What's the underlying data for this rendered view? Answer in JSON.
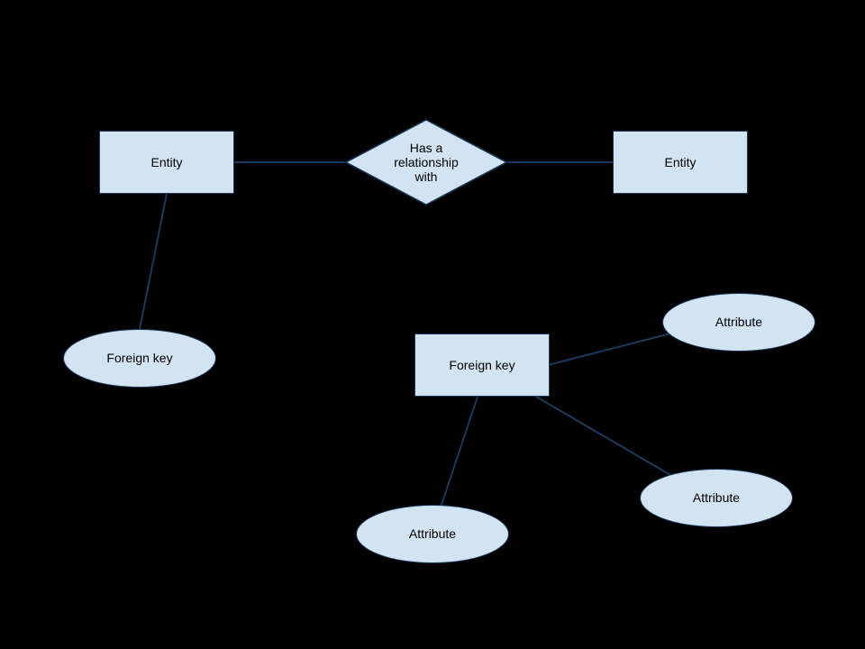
{
  "nodes": {
    "entity_left": "Entity",
    "entity_right": "Entity",
    "relationship": "Has a\nrelationship\nwith",
    "fk_ellipse": "Foreign key",
    "fk_rect": "Foreign key",
    "attr_top": "Attribute",
    "attr_bottom_left": "Attribute",
    "attr_bottom_right": "Attribute"
  }
}
